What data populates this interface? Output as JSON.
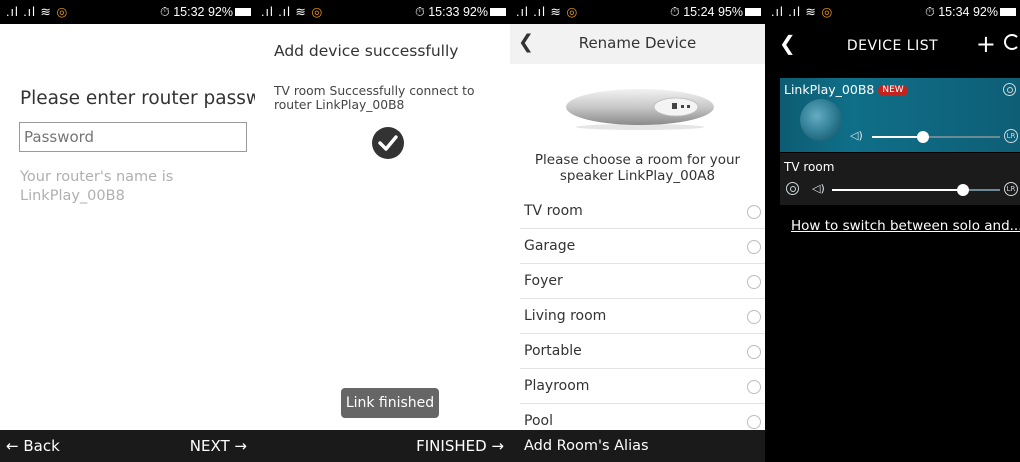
{
  "screens": [
    {
      "status": {
        "time": "15:32",
        "battery": "92%"
      },
      "title": "Please enter router password",
      "password_placeholder": "Password",
      "hint": "Your router's name is LinkPlay_00B8",
      "back_label": "← Back",
      "next_label": "NEXT →"
    },
    {
      "status": {
        "time": "15:33",
        "battery": "92%"
      },
      "title": "Add device successfully",
      "message": "TV room Successfully connect to router LinkPlay_00B8",
      "toast": "Link finished",
      "finished_label": "FINISHED →"
    },
    {
      "status": {
        "time": "15:24",
        "battery": "95%"
      },
      "title": "Rename Device",
      "prompt": "Please choose a room for your speaker  LinkPlay_00A8",
      "rooms": [
        "TV room",
        "Garage",
        "Foyer",
        "Living room",
        "Portable",
        "Playroom",
        "Pool"
      ],
      "alias_label": "Add Room's Alias"
    },
    {
      "status": {
        "time": "15:34",
        "battery": "92%"
      },
      "title": "DEVICE LIST",
      "devices": [
        {
          "name": "LinkPlay_00B8",
          "badge": "NEW",
          "volume": 0.4,
          "channel": "LR"
        },
        {
          "name": "TV room",
          "volume": 0.78,
          "channel": "LR"
        }
      ],
      "help_link": "How to switch between solo and..."
    }
  ],
  "colors": {
    "card_teal": "#0f6f88",
    "badge_red": "#c4221d"
  },
  "icons": [
    "back-arrow-icon",
    "checkmark-icon",
    "speaker-icon",
    "add-icon",
    "refresh-icon",
    "gear-icon",
    "volume-icon",
    "lr-channel-icon"
  ]
}
